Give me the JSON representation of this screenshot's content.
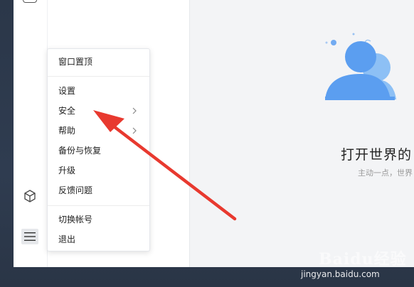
{
  "context_menu": {
    "items": [
      {
        "label": "窗口置顶"
      },
      {
        "label": "设置"
      },
      {
        "label": "安全",
        "has_submenu": true
      },
      {
        "label": "帮助",
        "has_submenu": true
      },
      {
        "label": "备份与恢复"
      },
      {
        "label": "升级"
      },
      {
        "label": "反馈问题"
      },
      {
        "label": "切换帐号"
      },
      {
        "label": "退出"
      }
    ]
  },
  "welcome": {
    "title": "打开世界的",
    "subtitle": "主动一点，世界"
  },
  "watermark": {
    "logo_text": "Baidu经验",
    "url": "jingyan.baidu.com"
  },
  "colors": {
    "annotation_arrow": "#e8392f",
    "illustration_blue": "#5b9ef0",
    "desktop_bg": "#2e3a4c"
  },
  "icons": [
    "cube-icon",
    "hamburger-menu-icon",
    "chevron-right-icon"
  ]
}
